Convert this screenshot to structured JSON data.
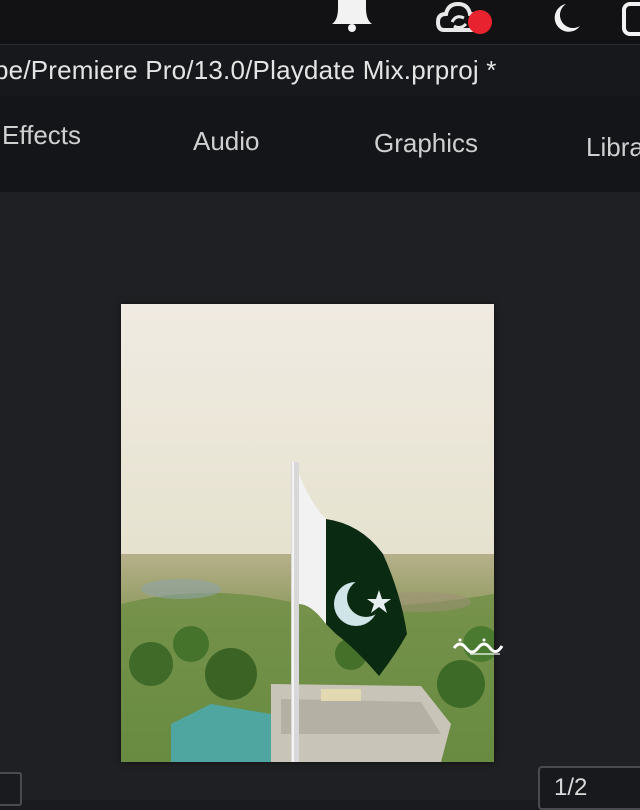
{
  "system_menubar": {
    "icons": [
      "notification-icon",
      "creative-cloud-sync-icon",
      "do-not-disturb-moon-icon",
      "app-icon"
    ],
    "badge_color": "#e8232f"
  },
  "title_bar": {
    "project_path": "pe/Premiere Pro/13.0/Playdate Mix.prproj *"
  },
  "workspaces": {
    "tabs": [
      {
        "label": "Effects"
      },
      {
        "label": "Audio"
      },
      {
        "label": "Graphics"
      },
      {
        "label": "Libra"
      }
    ]
  },
  "program_monitor": {
    "frame_content": "flag-of-pakistan-on-pole-aerial-view",
    "flag_colors": {
      "green": "#0b2a12",
      "white": "#f2f2f2"
    },
    "page_indicator": "1/2"
  }
}
